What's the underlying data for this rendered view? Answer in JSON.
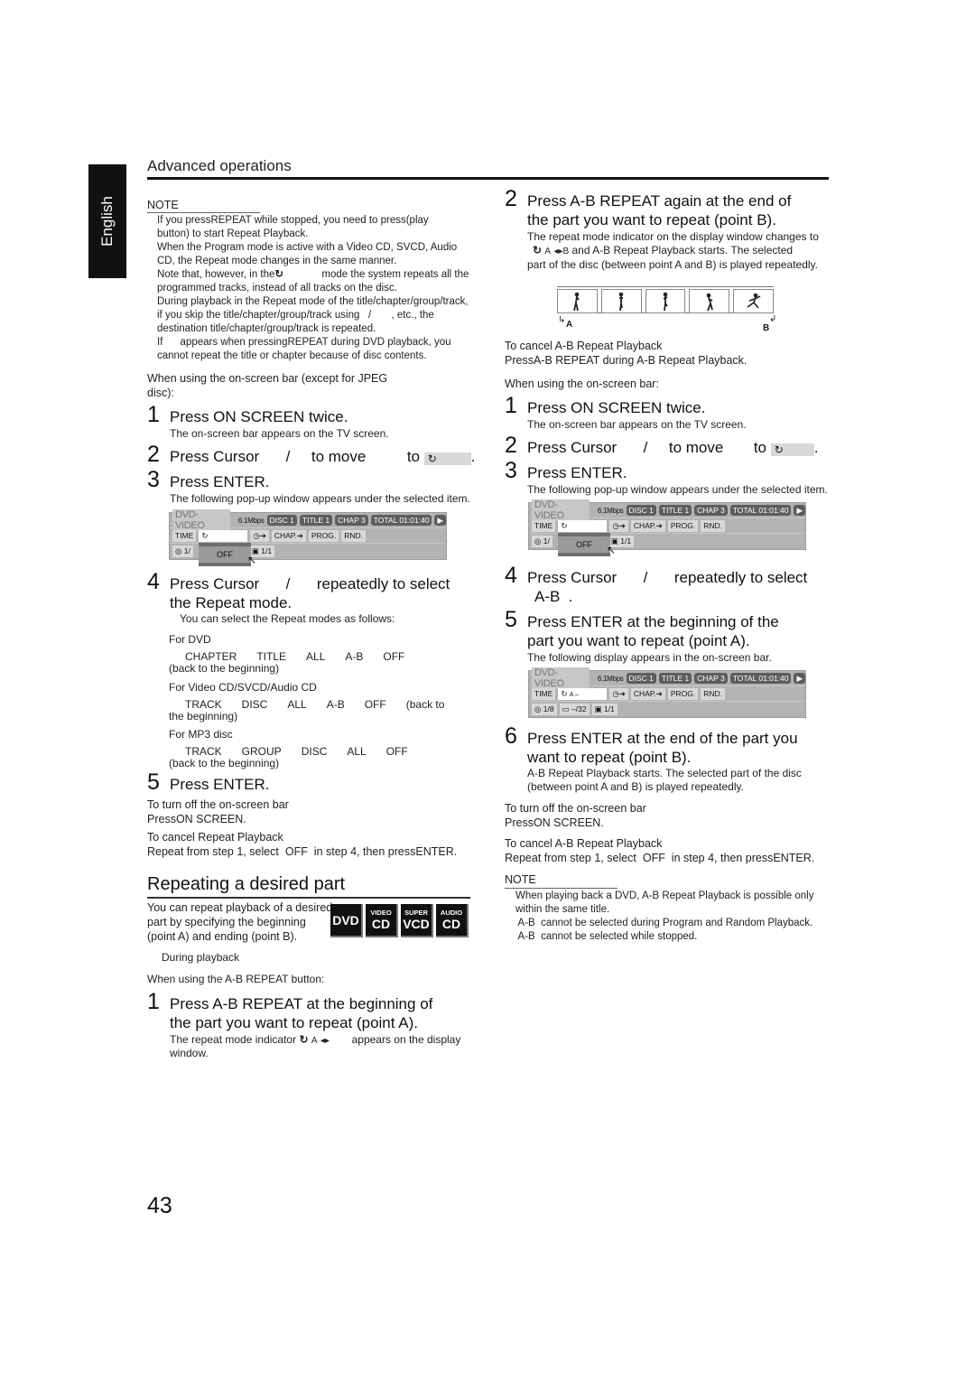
{
  "language_tab": "English",
  "section_header": "Advanced operations",
  "page_number": "43",
  "left": {
    "note": {
      "title": "NOTE",
      "lines": [
        "If you pressREPEAT while stopped, you need to press(play",
        "button) to start Repeat Playback.",
        "When the Program mode is active with a Video CD, SVCD, Audio",
        "CD, the Repeat mode changes in the same manner.",
        "Note that, however, in the",
        "mode the system repeats all the",
        "programmed tracks, instead of all tracks on the disc.",
        "During playback in the Repeat mode of the title/chapter/group/track,",
        "if you skip the title/chapter/group/track using   /       , etc., the",
        "destination title/chapter/group/track is repeated.",
        "If      appears when pressingREPEAT during DVD playback, you",
        "cannot repeat the title or chapter because of disc contents."
      ]
    },
    "intro": [
      "When using the on-screen bar (except for JPEG",
      "disc):"
    ],
    "steps": [
      {
        "num": "1",
        "text": "Press ON SCREEN twice.",
        "detail": "The on-screen bar appears on the TV screen."
      },
      {
        "num": "2",
        "text_a": "Press Cursor",
        "text_b": "/",
        "text_c": "to move",
        "text_d": "to",
        "text_e": "."
      },
      {
        "num": "3",
        "text": "Press ENTER.",
        "detail": "The following pop-up window appears under the selected item."
      },
      {
        "num": "4",
        "text_l1a": "Press Cursor",
        "text_l1b": "/",
        "text_l1c": "repeatedly to select",
        "text_l2": "the Repeat mode.",
        "detail": "You can select the Repeat modes as follows:"
      },
      {
        "num": "5",
        "text": "Press ENTER."
      }
    ],
    "modes": [
      {
        "label": "For DVD",
        "sequence": [
          "CHAPTER",
          "TITLE",
          "ALL",
          "A-B",
          "OFF"
        ],
        "tail": "(back to the beginning)"
      },
      {
        "label": "For Video CD/SVCD/Audio CD",
        "sequence": [
          "TRACK",
          "DISC",
          "ALL",
          "A-B",
          "OFF",
          "(back to"
        ],
        "tail": "the beginning)"
      },
      {
        "label": "For MP3 disc",
        "sequence": [
          "TRACK",
          "GROUP",
          "DISC",
          "ALL",
          "OFF"
        ],
        "tail": "(back to the beginning)"
      }
    ],
    "turn_off": {
      "title": "To turn off the on-screen bar",
      "body": "PressON SCREEN."
    },
    "cancel": {
      "title": "To cancel Repeat Playback",
      "body": "Repeat from step 1, select  OFF  in step 4, then pressENTER."
    },
    "repeating_part": {
      "heading": "Repeating a desired part",
      "desc": [
        "You can repeat playback of a desired",
        "part by specifying the beginning",
        "(point A) and ending (point B)."
      ],
      "badges": [
        {
          "top": "",
          "bottom": "DVD"
        },
        {
          "top": "VIDEO",
          "bottom": "CD"
        },
        {
          "top": "SUPER",
          "bottom": "VCD"
        },
        {
          "top": "AUDIO",
          "bottom": "CD"
        }
      ],
      "during": "During playback",
      "using_button": "When using the A-B REPEAT button:",
      "step1": {
        "num": "1",
        "l1": "Press A-B REPEAT at the beginning of",
        "l2": "the part you want to repeat (point A).",
        "d1a": "The repeat mode indicator",
        "d1b": "A",
        "d1c": "appears on the display",
        "d2": "window."
      }
    }
  },
  "right": {
    "step2": {
      "num": "2",
      "l1": "Press A-B REPEAT again at the end of",
      "l2": "the part you want to repeat (point B).",
      "d1": "The repeat mode indicator on the display window changes to",
      "d2a": "A",
      "d2b": "B",
      "d2c": "and A-B Repeat Playback starts. The selected",
      "d3": "part of the disc (between point A and B) is played repeatedly."
    },
    "strip_labels": {
      "a": "A",
      "b": "B"
    },
    "cancel_ab": {
      "title": "To cancel A-B Repeat Playback",
      "body": "PressA-B REPEAT during A-B Repeat Playback."
    },
    "intro": "When using the on-screen bar:",
    "steps": [
      {
        "num": "1",
        "text": "Press ON SCREEN twice.",
        "detail": "The on-screen bar appears on the TV screen."
      },
      {
        "num": "2",
        "text_a": "Press Cursor",
        "text_b": "/",
        "text_c": "to move",
        "text_d": "to",
        "text_e": "."
      },
      {
        "num": "3",
        "text": "Press ENTER.",
        "detail": "The following pop-up window appears under the selected item."
      },
      {
        "num": "4",
        "l1a": "Press Cursor",
        "l1b": "/",
        "l1c": "repeatedly to select",
        "l2": "A-B  ."
      },
      {
        "num": "5",
        "l1": "Press ENTER at the beginning of the",
        "l2": "part you want to repeat (point A).",
        "detail": "The following display appears in the on-screen bar."
      },
      {
        "num": "6",
        "l1": "Press ENTER at the end of the part you",
        "l2": "want to repeat (point B).",
        "d1": "A-B Repeat Playback starts. The selected part of the disc",
        "d2": "(between point A and B) is played repeatedly."
      }
    ],
    "turn_off": {
      "title": "To turn off the on-screen bar",
      "body": "PressON SCREEN."
    },
    "cancel": {
      "title": "To cancel A-B Repeat Playback",
      "body": "Repeat from step 1, select  OFF  in step 4, then pressENTER."
    },
    "note": {
      "title": "NOTE",
      "lines": [
        "When playing back a DVD, A-B Repeat Playback is possible only",
        "within the same title.",
        " A-B  cannot be selected during Program and Random Playback.",
        " A-B  cannot be selected while stopped."
      ]
    }
  },
  "osb": {
    "disc_type": "DVD-VIDEO",
    "bitrate": "6.1Mbps",
    "disc": "DISC 1",
    "title": "TITLE  1",
    "chap": "CHAP  3",
    "total": "TOTAL 01:01:40",
    "time": "TIME",
    "chap_btn": "CHAP.",
    "prog": "PROG.",
    "rnd": "RND.",
    "audio": "1/",
    "angle": "1/1",
    "popup_value": "OFF",
    "ab_value": "A –",
    "audio_full": "1/8",
    "subtitle": "–/32"
  }
}
